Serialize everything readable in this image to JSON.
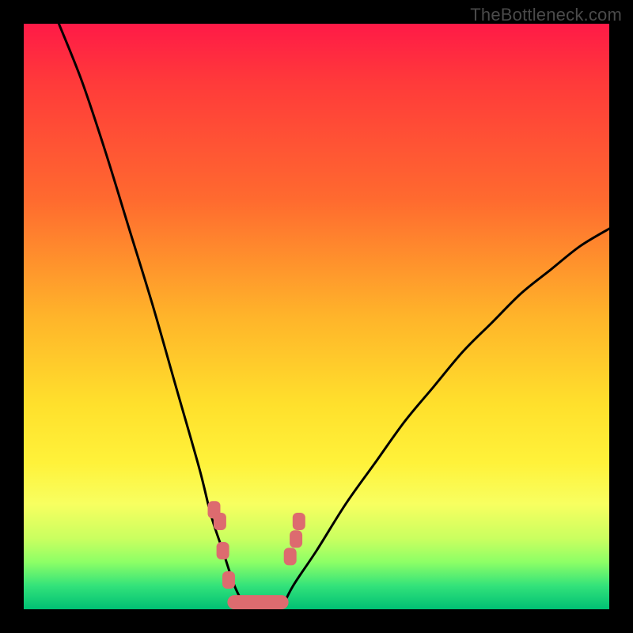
{
  "watermark": "TheBottleneck.com",
  "chart_data": {
    "type": "line",
    "title": "",
    "xlabel": "",
    "ylabel": "",
    "xlim": [
      0,
      100
    ],
    "ylim": [
      0,
      100
    ],
    "background_gradient": {
      "top": "#ff1a47",
      "upper_mid": "#ffb42a",
      "mid": "#fff23a",
      "lower_mid": "#8cff66",
      "bottom": "#00c074"
    },
    "series": [
      {
        "name": "curve-left",
        "color": "#000000",
        "x": [
          6,
          10,
          14,
          18,
          22,
          26,
          30,
          32,
          34,
          36,
          38
        ],
        "y": [
          100,
          90,
          78,
          65,
          52,
          38,
          24,
          16,
          10,
          4,
          0
        ]
      },
      {
        "name": "curve-right",
        "color": "#000000",
        "x": [
          44,
          46,
          50,
          55,
          60,
          65,
          70,
          75,
          80,
          85,
          90,
          95,
          100
        ],
        "y": [
          0,
          4,
          10,
          18,
          25,
          32,
          38,
          44,
          49,
          54,
          58,
          62,
          65
        ]
      },
      {
        "name": "marker-cluster-left",
        "color": "#dd6b6f",
        "x": [
          32.5,
          33.5,
          34,
          35
        ],
        "y": [
          17,
          15,
          10,
          5
        ]
      },
      {
        "name": "marker-cluster-right",
        "color": "#dd6b6f",
        "x": [
          45.5,
          46.5,
          47
        ],
        "y": [
          9,
          12,
          15
        ]
      },
      {
        "name": "bottom-band",
        "color": "#dd6b6f",
        "x": [
          36,
          38,
          40,
          42,
          44
        ],
        "y": [
          1.2,
          1.2,
          1.2,
          1.2,
          1.2
        ]
      }
    ]
  }
}
